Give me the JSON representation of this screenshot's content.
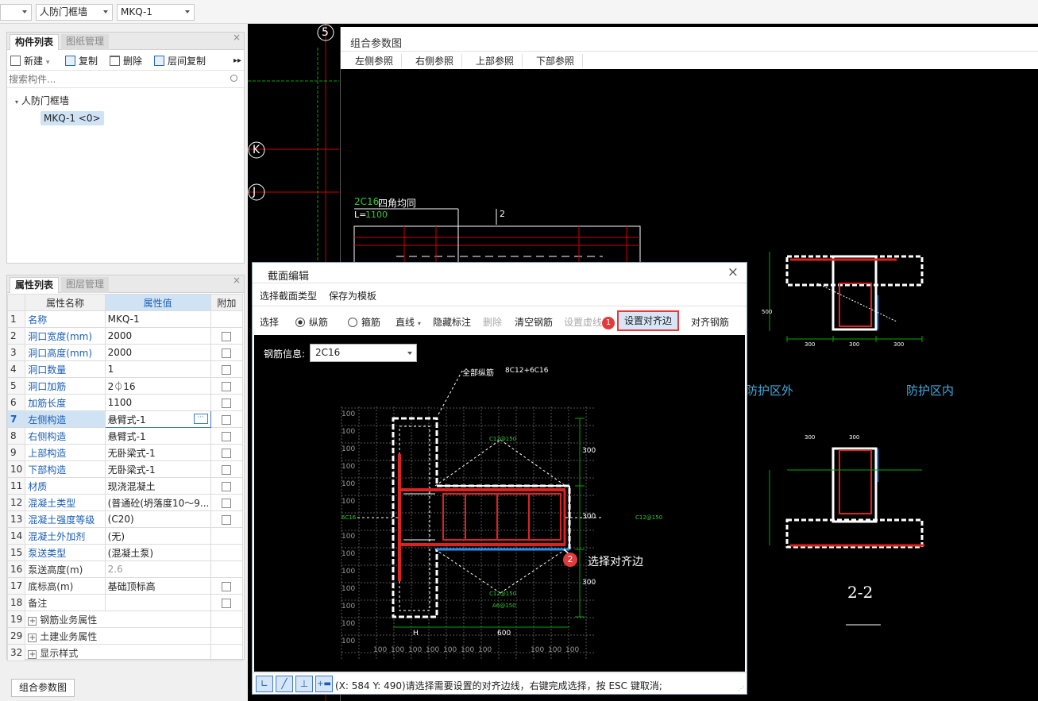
{
  "topbar": {
    "combo1": "",
    "combo2": "人防门框墙",
    "combo3": "MKQ-1"
  },
  "component_panel": {
    "tabs": [
      "构件列表",
      "图纸管理"
    ],
    "toolbar": {
      "new": "新建",
      "copy": "复制",
      "delete": "删除",
      "floor_copy": "层间复制"
    },
    "search_placeholder": "搜索构件...",
    "tree_parent": "人防门框墙",
    "tree_child": "MKQ-1 <0>"
  },
  "property_panel": {
    "tabs": [
      "属性列表",
      "图层管理"
    ],
    "headers": {
      "name": "属性名称",
      "value": "属性值",
      "extra": "附加"
    },
    "rows": [
      {
        "n": "1",
        "name": "名称",
        "value": "MKQ-1"
      },
      {
        "n": "2",
        "name": "洞口宽度(mm)",
        "value": "2000"
      },
      {
        "n": "3",
        "name": "洞口高度(mm)",
        "value": "2000"
      },
      {
        "n": "4",
        "name": "洞口数量",
        "value": "1"
      },
      {
        "n": "5",
        "name": "洞口加筋",
        "value": "2⏀16"
      },
      {
        "n": "6",
        "name": "加筋长度",
        "value": "1100"
      },
      {
        "n": "7",
        "name": "左侧构造",
        "value": "悬臂式-1"
      },
      {
        "n": "8",
        "name": "右侧构造",
        "value": "悬臂式-1"
      },
      {
        "n": "9",
        "name": "上部构造",
        "value": "无卧梁式-1"
      },
      {
        "n": "10",
        "name": "下部构造",
        "value": "无卧梁式-1"
      },
      {
        "n": "11",
        "name": "材质",
        "value": "现浇混凝土"
      },
      {
        "n": "12",
        "name": "混凝土类型",
        "value": "(普通砼(坍落度10～9..."
      },
      {
        "n": "13",
        "name": "混凝土强度等级",
        "value": "(C20)"
      },
      {
        "n": "14",
        "name": "混凝土外加剂",
        "value": "(无)"
      },
      {
        "n": "15",
        "name": "泵送类型",
        "value": "(混凝土泵)"
      },
      {
        "n": "16",
        "name": "泵送高度(m)",
        "value": "2.6"
      },
      {
        "n": "17",
        "name": "底标高(m)",
        "value": "基础顶标高"
      },
      {
        "n": "18",
        "name": "备注",
        "value": ""
      },
      {
        "n": "19",
        "name": "钢筋业务属性",
        "value": ""
      },
      {
        "n": "29",
        "name": "土建业务属性",
        "value": ""
      },
      {
        "n": "32",
        "name": "显示样式",
        "value": ""
      }
    ],
    "bottom_button": "组合参数图"
  },
  "combo_view": {
    "title": "组合参数图",
    "tabs": [
      "左侧参照",
      "右侧参照",
      "上部参照",
      "下部参照"
    ],
    "axis_labels": [
      "5",
      "K",
      "J"
    ],
    "rebar_note_code": "2C16",
    "rebar_note_text": "四角均同",
    "length_label": "L=",
    "length_value": "1100",
    "section_mark": "2",
    "zone_outer": "防护区外",
    "zone_inner": "防护区内",
    "section_title": "2-2",
    "dims": [
      "300",
      "300",
      "300",
      "300",
      "300",
      "500"
    ]
  },
  "dialog": {
    "title": "截面编辑",
    "menu": [
      "选择截面类型",
      "保存为模板"
    ],
    "toolbar": {
      "select": "选择",
      "longitudinal": "纵筋",
      "stirrup": "箍筋",
      "line": "直线",
      "hide_label": "隐藏标注",
      "delete": "删除",
      "clear": "清空钢筋",
      "set_dashed": "设置虚线",
      "set_align_edge": "设置对齐边",
      "align_rebar": "对齐钢筋"
    },
    "rebar_info_label": "钢筋信息:",
    "rebar_info_value": "2C16",
    "callout_all_long": "全部纵筋",
    "callout_all_long_value": "8C12+6C16",
    "step1": "1",
    "step2": "2",
    "step2_text": "选择对齐边",
    "drawing_labels": {
      "grid": [
        "100",
        "100",
        "100",
        "100",
        "100",
        "100",
        "100",
        "100",
        "100",
        "100",
        "100",
        "100",
        "100",
        "100",
        "100",
        "100",
        "100",
        "100",
        "100",
        "100",
        "100",
        "100",
        "100"
      ],
      "dim_300a": "300",
      "dim_300b": "300",
      "dim_300c": "300",
      "dim_600": "600",
      "dim_h": "H",
      "stirrup1": "C12@150",
      "stirrup2": "C12@150",
      "stirrup3": "C12@150",
      "stirrup4": "A6@150",
      "side": "6C16"
    },
    "status": "(X: 584 Y: 490)请选择需要设置的对齐边线，右键完成选择，按 ESC 键取消;"
  }
}
